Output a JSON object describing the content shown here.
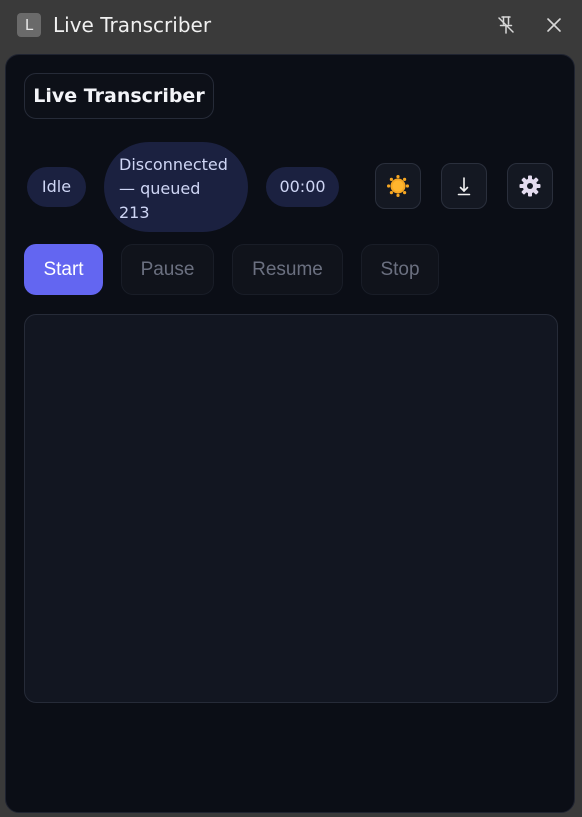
{
  "window": {
    "app_icon_letter": "L",
    "title": "Live Transcriber",
    "pin_icon": "unpin-icon",
    "close_icon": "close-icon"
  },
  "header": {
    "title": "Live Transcriber"
  },
  "status": {
    "state": "Idle",
    "connection_line1": "Disconnected",
    "connection_line2": "— queued",
    "connection_line3": "213",
    "timer": "00:00"
  },
  "tools": {
    "theme_icon": "sun-icon",
    "download_icon": "download-icon",
    "settings_icon": "gear-icon",
    "theme_color": "#f5a623"
  },
  "controls": {
    "start": "Start",
    "pause": "Pause",
    "resume": "Resume",
    "stop": "Stop",
    "accent": "#6366f1"
  },
  "transcript": {
    "text": ""
  }
}
